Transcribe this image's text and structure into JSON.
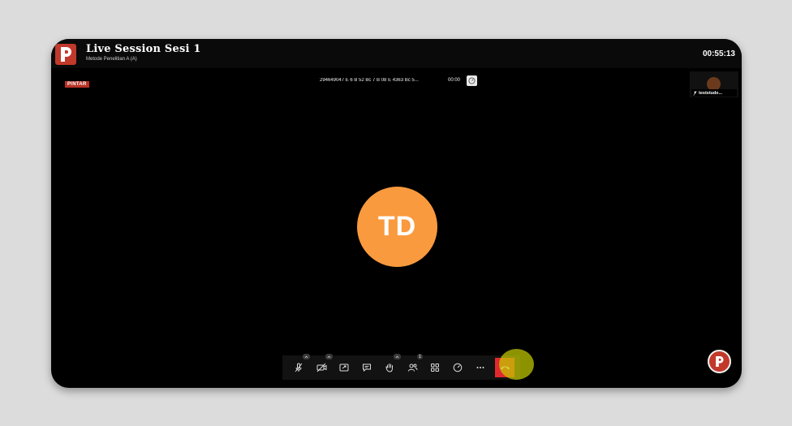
{
  "header": {
    "title": "Live Session Sesi 1",
    "subtitle": "Metode Penelitian A (A)",
    "timer": "00:55:13"
  },
  "brand": {
    "label": "PINTAR",
    "color": "#b83226"
  },
  "recording": {
    "id": "294649047 E 6 B 52 Bc 7 B 08 E 4363 Bc 5...",
    "time": "00:00"
  },
  "participant_thumb": {
    "name": "teststude..."
  },
  "main_avatar": {
    "initials": "TD",
    "color": "#fa9a3f"
  },
  "toolbar": {
    "items": [
      {
        "icon": "mic-off-icon"
      },
      {
        "icon": "camera-off-icon"
      },
      {
        "icon": "share-screen-icon"
      },
      {
        "icon": "chat-icon"
      },
      {
        "icon": "raise-hand-icon"
      },
      {
        "icon": "participants-icon",
        "badge": "1"
      },
      {
        "icon": "grid-layout-icon"
      },
      {
        "icon": "performance-icon"
      },
      {
        "icon": "more-icon"
      },
      {
        "icon": "leave-call-icon",
        "color": "#e0282f"
      }
    ]
  },
  "colors": {
    "accent": "#c0392b",
    "highlight": "#c4cc00"
  }
}
